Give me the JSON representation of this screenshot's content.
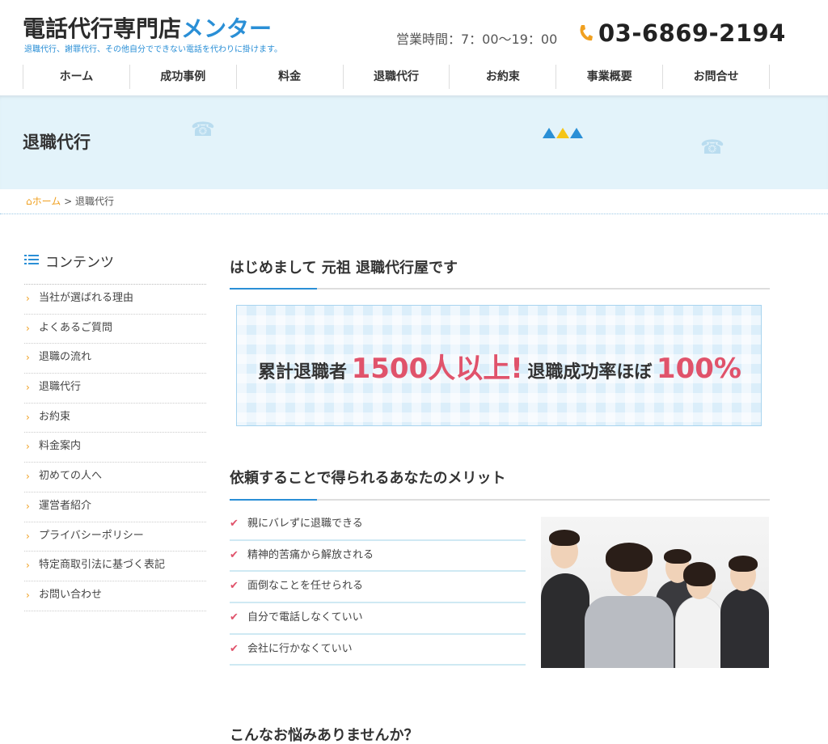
{
  "header": {
    "logo_dark": "電話代行専門店",
    "logo_blue": "メンター",
    "tagline": "退職代行、謝罪代行、その他自分でできない電話を代わりに掛けます。",
    "hours": "営業時間：7：00〜19：00",
    "phone": "03-6869-2194",
    "phone_icon": "phone-icon"
  },
  "nav": [
    "ホーム",
    "成功事例",
    "料金",
    "退職代行",
    "お約束",
    "事業概要",
    "お問合せ"
  ],
  "banner": {
    "title": "退職代行"
  },
  "breadcrumb": {
    "home": "ホーム",
    "separator": ">",
    "current": "退職代行"
  },
  "sidebar": {
    "title": "コンテンツ",
    "items": [
      "当社が選ばれる理由",
      "よくあるご質問",
      "退職の流れ",
      "退職代行",
      "お約束",
      "料金案内",
      "初めての人へ",
      "運営者紹介",
      "プライバシーポリシー",
      "特定商取引法に基づく表記",
      "お問い合わせ"
    ]
  },
  "main": {
    "heading1": "はじめまして 元祖 退職代行屋です",
    "stat": {
      "part1": "累計退職者",
      "big1": "1500人以上!",
      "part2": "退職成功率ほぼ",
      "big2": "100%"
    },
    "heading2": "依頼することで得られるあなたのメリット",
    "benefits": [
      "親にバレずに退職できる",
      "精神的苦痛から解放される",
      "面倒なことを任せられる",
      "自分で電話しなくていい",
      "会社に行かなくていい"
    ],
    "heading3": "こんなお悩みありませんか？"
  },
  "colors": {
    "accent_blue": "#2a8fd6",
    "accent_orange": "#f0a020",
    "accent_pink": "#e0536b",
    "banner_bg": "#e3f3fa"
  }
}
